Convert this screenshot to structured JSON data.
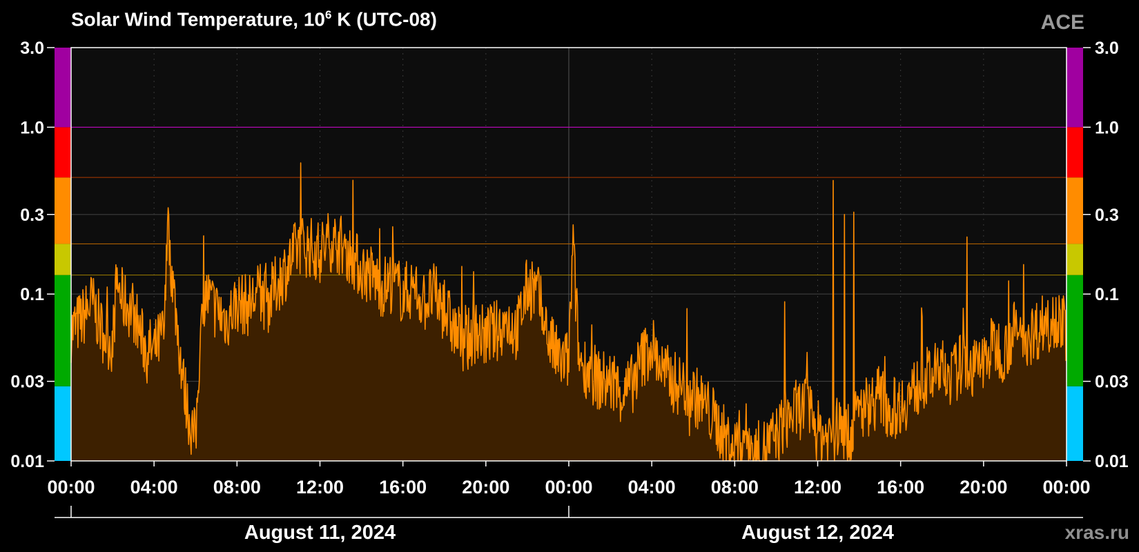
{
  "header": {
    "title_main": "Solar Wind Temperature, 10",
    "title_exp": "6",
    "title_tail": " K (UTC-08)",
    "source": "ACE",
    "site": "xras.ru"
  },
  "chart_data": {
    "type": "area",
    "title": "Solar Wind Temperature, 10^6 K (UTC-08)",
    "ylabel": "",
    "xlabel": "",
    "y_scale": "log",
    "ylim": [
      0.01,
      3.0
    ],
    "y_ticks": [
      0.01,
      0.03,
      0.1,
      0.3,
      1.0,
      3.0
    ],
    "y_tick_labels": [
      "0.01",
      "0.03",
      "0.1",
      "0.3",
      "1.0",
      "3.0"
    ],
    "x_range_hours": [
      0,
      48
    ],
    "x_ticks_hours": [
      0,
      4,
      8,
      12,
      16,
      20,
      24,
      28,
      32,
      36,
      40,
      44,
      48
    ],
    "x_tick_labels": [
      "00:00",
      "04:00",
      "08:00",
      "12:00",
      "16:00",
      "20:00",
      "00:00",
      "04:00",
      "08:00",
      "12:00",
      "16:00",
      "20:00",
      "00:00"
    ],
    "date_labels": [
      {
        "label": "August 11, 2024",
        "center_hour": 12
      },
      {
        "label": "August 12, 2024",
        "center_hour": 36
      }
    ],
    "threshold_lines": [
      {
        "value": 1.0,
        "color": "#cc00cc"
      },
      {
        "value": 0.5,
        "color": "#b03a00"
      },
      {
        "value": 0.2,
        "color": "#c26a00"
      },
      {
        "value": 0.13,
        "color": "#a08000"
      }
    ],
    "scale_bands": [
      {
        "from": 0.01,
        "to": 0.028,
        "color": "#00c8ff"
      },
      {
        "from": 0.028,
        "to": 0.13,
        "color": "#00aa00"
      },
      {
        "from": 0.13,
        "to": 0.2,
        "color": "#c8c800"
      },
      {
        "from": 0.2,
        "to": 0.5,
        "color": "#ff8c00"
      },
      {
        "from": 0.5,
        "to": 1.0,
        "color": "#ff0000"
      },
      {
        "from": 1.0,
        "to": 3.0,
        "color": "#a000a0"
      }
    ],
    "series": [
      {
        "line_color": "#ff8c00",
        "fill_color": "#3d2000",
        "x_hours": [
          0,
          0.5,
          1,
          1.5,
          2,
          2.2,
          2.5,
          3,
          3.5,
          4,
          4.5,
          4.65,
          5,
          5.4,
          5.7,
          6,
          6.2,
          6.5,
          7,
          7.5,
          8,
          8.5,
          9,
          9.5,
          10,
          10.5,
          11,
          11.5,
          12,
          12.5,
          13,
          13.5,
          14,
          14.5,
          15,
          15.5,
          16,
          16.5,
          17,
          17.5,
          18,
          18.5,
          19,
          19.5,
          20,
          20.5,
          21,
          21.5,
          22,
          22.5,
          23,
          23.5,
          24,
          24.2,
          24.5,
          25,
          25.5,
          26,
          26.5,
          27,
          27.5,
          28,
          28.5,
          29,
          29.5,
          30,
          30.5,
          31,
          31.5,
          32,
          32.5,
          33,
          33.5,
          34,
          34.5,
          35,
          35.5,
          36,
          36.5,
          37,
          37.5,
          38,
          38.5,
          39,
          39.5,
          40,
          40.5,
          41,
          41.5,
          42,
          42.5,
          43,
          43.5,
          44,
          44.5,
          45,
          45.5,
          46,
          46.5,
          47,
          47.5,
          48
        ],
        "values": [
          0.06,
          0.07,
          0.09,
          0.06,
          0.05,
          0.12,
          0.09,
          0.08,
          0.05,
          0.045,
          0.06,
          0.25,
          0.09,
          0.03,
          0.018,
          0.013,
          0.05,
          0.1,
          0.08,
          0.07,
          0.09,
          0.085,
          0.1,
          0.09,
          0.12,
          0.15,
          0.2,
          0.19,
          0.18,
          0.21,
          0.2,
          0.17,
          0.14,
          0.13,
          0.11,
          0.12,
          0.1,
          0.11,
          0.09,
          0.1,
          0.08,
          0.06,
          0.05,
          0.06,
          0.055,
          0.06,
          0.07,
          0.06,
          0.11,
          0.1,
          0.055,
          0.04,
          0.04,
          0.2,
          0.04,
          0.035,
          0.03,
          0.03,
          0.025,
          0.028,
          0.04,
          0.05,
          0.035,
          0.03,
          0.028,
          0.025,
          0.022,
          0.018,
          0.014,
          0.012,
          0.015,
          0.011,
          0.012,
          0.014,
          0.018,
          0.02,
          0.022,
          0.015,
          0.014,
          0.016,
          0.014,
          0.02,
          0.022,
          0.025,
          0.02,
          0.022,
          0.025,
          0.03,
          0.032,
          0.035,
          0.032,
          0.04,
          0.035,
          0.04,
          0.05,
          0.045,
          0.06,
          0.055,
          0.06,
          0.07,
          0.075,
          0.06,
          0.05,
          0.055
        ]
      }
    ],
    "spikes": [
      {
        "hour": 4.65,
        "value": 0.27
      },
      {
        "hour": 24.2,
        "value": 0.26
      },
      {
        "hour": 36.75,
        "value": 0.48
      },
      {
        "hour": 37.3,
        "value": 0.3
      },
      {
        "hour": 37.75,
        "value": 0.31
      },
      {
        "hour": 43.2,
        "value": 0.22
      },
      {
        "hour": 45.2,
        "value": 0.12
      },
      {
        "hour": 34.4,
        "value": 0.09
      }
    ]
  }
}
